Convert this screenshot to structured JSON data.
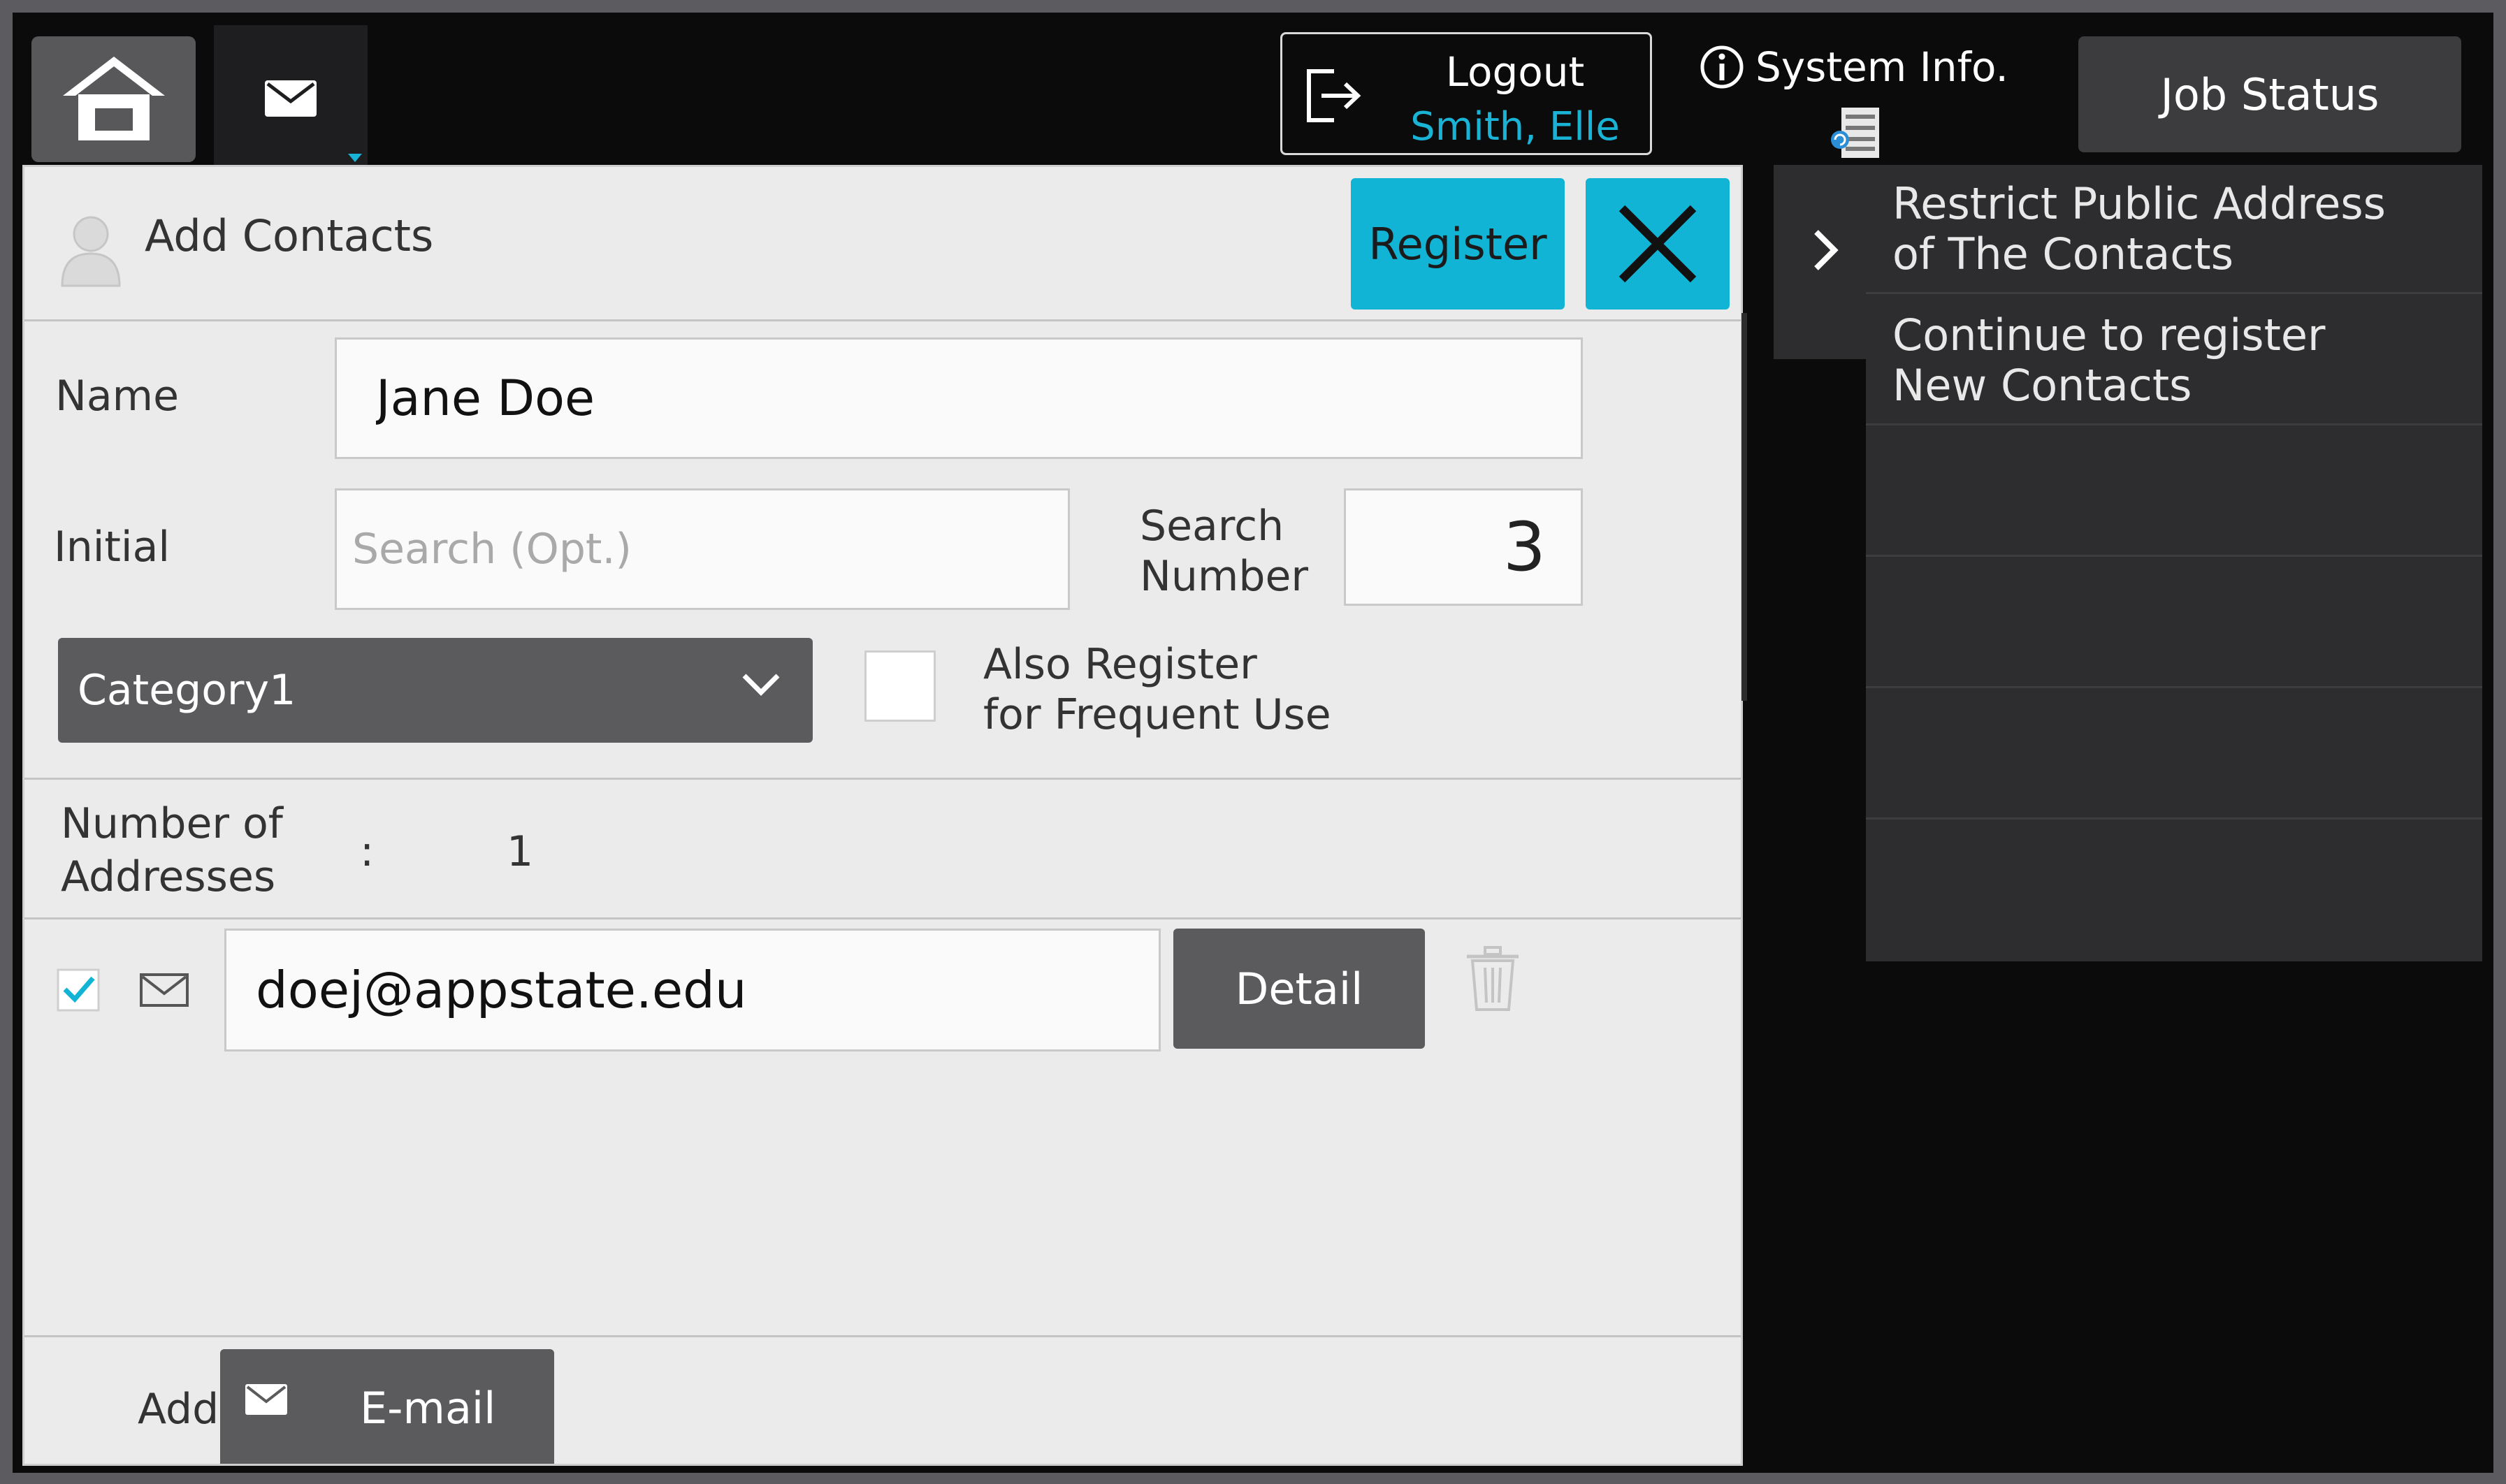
{
  "topbar": {
    "home_icon": "home-icon",
    "mail_tab_icon": "envelope-icon",
    "logout_label": "Logout",
    "logout_user": "Smith, Elle",
    "system_info_label": "System Info.",
    "job_status_label": "Job Status"
  },
  "dialog": {
    "title": "Add Contacts",
    "register_label": "Register",
    "close_icon": "close-icon"
  },
  "form": {
    "name_label": "Name",
    "name_value": "Jane Doe",
    "initial_label": "Initial",
    "initial_placeholder": "Search (Opt.)",
    "search_number_label_line1": "Search",
    "search_number_label_line2": "Number",
    "search_number_value": "3",
    "category_value": "Category1",
    "frequent_use_line1": "Also Register",
    "frequent_use_line2": "for Frequent Use",
    "frequent_use_checked": false
  },
  "addresses": {
    "count_label_line1": "Number of",
    "count_label_line2": "Addresses",
    "separator": ":",
    "count_value": "1",
    "items": [
      {
        "type": "email",
        "value": "doej@appstate.edu",
        "checked": true,
        "detail_label": "Detail"
      }
    ]
  },
  "add_bar": {
    "add_label": "Add",
    "email_button_label": "E-mail"
  },
  "side_menu": {
    "items": [
      {
        "line1": "Restrict Public Address",
        "line2": "of The Contacts"
      },
      {
        "line1": "Continue to register",
        "line2": "New Contacts"
      },
      {
        "line1": "",
        "line2": ""
      },
      {
        "line1": "",
        "line2": ""
      },
      {
        "line1": "",
        "line2": ""
      }
    ]
  },
  "colors": {
    "accent": "#12b4d6",
    "dark_button": "#5b5b5e",
    "background": "#0b0b0c",
    "panel": "#ebebeb"
  }
}
